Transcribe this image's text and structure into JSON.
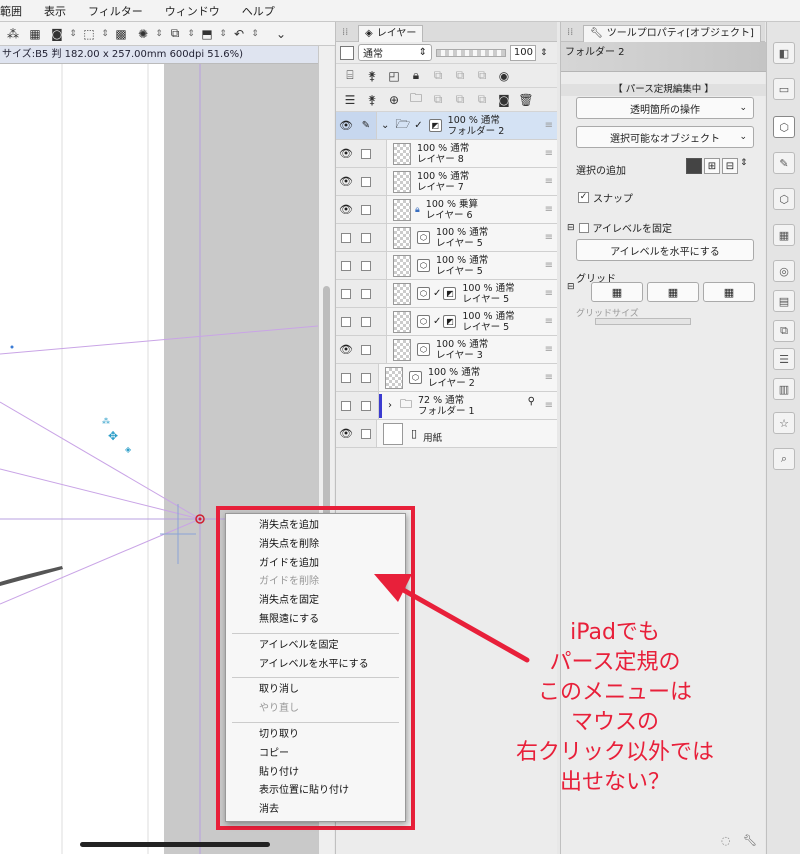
{
  "menubar": {
    "items": [
      "範囲",
      "表示",
      "フィルター",
      "ウィンドウ",
      "ヘルプ"
    ]
  },
  "canvas": {
    "info": "サイズ:B5 判 182.00 x 257.00mm 600dpi 51.6%)"
  },
  "layer_panel": {
    "tab": "レイヤー",
    "blend_mode": "通常",
    "opacity": "100",
    "layers": [
      {
        "line1": "100 % 通常",
        "line2": "フォルダー 2",
        "visible": true,
        "selected": true,
        "kind": "folder"
      },
      {
        "line1": "100 % 通常",
        "line2": "レイヤー 8",
        "visible": true,
        "kind": "raster"
      },
      {
        "line1": "100 % 通常",
        "line2": "レイヤー 7",
        "visible": true,
        "kind": "raster"
      },
      {
        "line1": "100 % 乗算",
        "line2": "レイヤー 6",
        "visible": true,
        "kind": "raster"
      },
      {
        "line1": "100 % 通常",
        "line2": "レイヤー 5",
        "visible": false,
        "kind": "3d"
      },
      {
        "line1": "100 % 通常",
        "line2": "レイヤー 5",
        "visible": false,
        "kind": "3d"
      },
      {
        "line1": "100 % 通常",
        "line2": "レイヤー 5",
        "visible": false,
        "kind": "ruler"
      },
      {
        "line1": "100 % 通常",
        "line2": "レイヤー 5",
        "visible": false,
        "kind": "ruler"
      },
      {
        "line1": "100 % 通常",
        "line2": "レイヤー 3",
        "visible": true,
        "kind": "3d"
      },
      {
        "line1": "100 % 通常",
        "line2": "レイヤー 2",
        "visible": false,
        "kind": "3d"
      },
      {
        "line1": "72 % 通常",
        "line2": "フォルダー 1",
        "visible": false,
        "kind": "folder-closed"
      },
      {
        "line1": "",
        "line2": "用紙",
        "visible": true,
        "kind": "paper"
      }
    ]
  },
  "tool_property": {
    "tab": "ツールプロパティ[オブジェクト]",
    "title": "フォルダー 2",
    "status": "【 パース定規編集中 】",
    "dropdown1": "透明箇所の操作",
    "dropdown2": "選択可能なオブジェクト",
    "selection_add_label": "選択の追加",
    "snap_label": "スナップ",
    "eye_level_fix_label": "アイレベルを固定",
    "eye_level_horizontal_button": "アイレベルを水平にする",
    "grid_label": "グリッド",
    "grid_size_label": "グリッドサイズ"
  },
  "context_menu": {
    "groups": [
      [
        {
          "label": "消失点を追加"
        },
        {
          "label": "消失点を削除"
        },
        {
          "label": "ガイドを追加"
        },
        {
          "label": "ガイドを削除",
          "disabled": true
        },
        {
          "label": "消失点を固定"
        },
        {
          "label": "無限遠にする"
        }
      ],
      [
        {
          "label": "アイレベルを固定"
        },
        {
          "label": "アイレベルを水平にする"
        }
      ],
      [
        {
          "label": "取り消し"
        },
        {
          "label": "やり直し",
          "disabled": true
        }
      ],
      [
        {
          "label": "切り取り"
        },
        {
          "label": "コピー"
        },
        {
          "label": "貼り付け"
        },
        {
          "label": "表示位置に貼り付け"
        },
        {
          "label": "消去"
        }
      ]
    ]
  },
  "annotation": {
    "lines": [
      "iPadでも",
      "パース定規の",
      "このメニューは",
      "マウスの",
      "右クリック以外では",
      "出せない？"
    ],
    "color": "#e8203a"
  }
}
